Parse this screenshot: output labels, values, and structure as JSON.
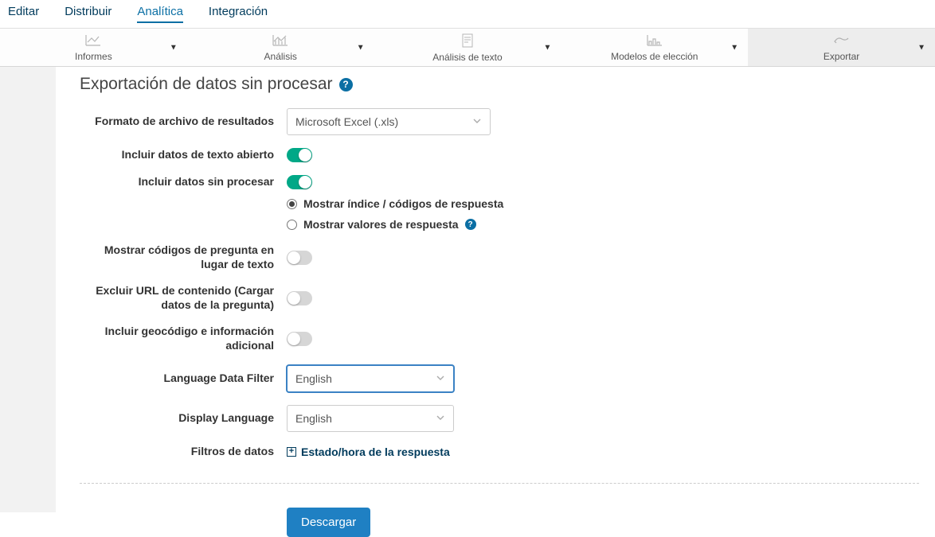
{
  "top_tabs": {
    "editar": "Editar",
    "distribuir": "Distribuir",
    "analitica": "Analítica",
    "integracion": "Integración"
  },
  "toolbar": {
    "informes": "Informes",
    "analisis": "Análisis",
    "analisis_texto": "Análisis de texto",
    "modelos": "Modelos de elección",
    "exportar": "Exportar"
  },
  "page": {
    "title": "Exportación de datos sin procesar"
  },
  "form": {
    "formato_label": "Formato de archivo de resultados",
    "formato_value": "Microsoft Excel (.xls)",
    "incluir_texto_abierto": "Incluir datos de texto abierto",
    "incluir_sin_procesar": "Incluir datos sin procesar",
    "radio_indice": "Mostrar índice / códigos de respuesta",
    "radio_valores": "Mostrar valores de respuesta",
    "mostrar_codigos": "Mostrar códigos de pregunta en lugar de texto",
    "excluir_url": "Excluir URL de contenido (Cargar datos de la pregunta)",
    "incluir_geo": "Incluir geocódigo e información adicional",
    "language_filter_label": "Language Data Filter",
    "language_filter_value": "English",
    "display_language_label": "Display Language",
    "display_language_value": "English",
    "filtros_label": "Filtros de datos",
    "filtros_link": "Estado/hora de la respuesta",
    "descargar": "Descargar"
  }
}
